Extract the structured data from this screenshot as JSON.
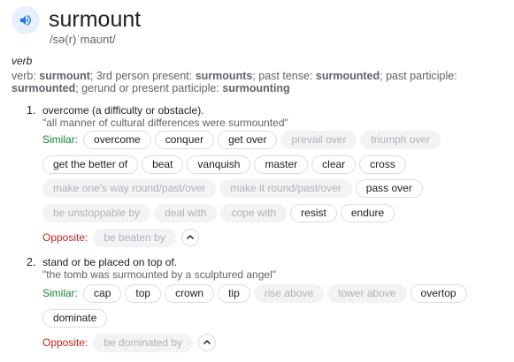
{
  "entry": {
    "word": "surmount",
    "phonetic": "/sə(r)ˈmaʊnt/",
    "part_of_speech": "verb",
    "forms": {
      "prefix": "verb: ",
      "base": "surmount",
      "sep1": "; 3rd person present: ",
      "third_person": "surmounts",
      "sep2": "; past tense: ",
      "past": "surmounted",
      "sep3": "; past participle: ",
      "past_participle": "surmounted",
      "sep4": "; gerund or present participle: ",
      "gerund": "surmounting"
    }
  },
  "senses": [
    {
      "number": "1.",
      "definition": "overcome (a difficulty or obstacle).",
      "example": "\"all manner of cultural differences were surmounted\"",
      "similar_label": "Similar:",
      "similar_rows": [
        [
          {
            "text": "overcome",
            "enabled": true
          },
          {
            "text": "conquer",
            "enabled": true
          },
          {
            "text": "get over",
            "enabled": true
          },
          {
            "text": "prevail over",
            "enabled": false
          },
          {
            "text": "triumph over",
            "enabled": false
          }
        ],
        [
          {
            "text": "get the better of",
            "enabled": true
          },
          {
            "text": "beat",
            "enabled": true
          },
          {
            "text": "vanquish",
            "enabled": true
          },
          {
            "text": "master",
            "enabled": true
          },
          {
            "text": "clear",
            "enabled": true
          },
          {
            "text": "cross",
            "enabled": true
          }
        ],
        [
          {
            "text": "make one's way round/past/over",
            "enabled": false
          },
          {
            "text": "make it round/past/over",
            "enabled": false
          },
          {
            "text": "pass over",
            "enabled": true
          }
        ],
        [
          {
            "text": "be unstoppable by",
            "enabled": false
          },
          {
            "text": "deal with",
            "enabled": false
          },
          {
            "text": "cope with",
            "enabled": false
          },
          {
            "text": "resist",
            "enabled": true
          },
          {
            "text": "endure",
            "enabled": true
          }
        ]
      ],
      "opposite_label": "Opposite:",
      "opposites": [
        {
          "text": "be beaten by",
          "enabled": false
        }
      ]
    },
    {
      "number": "2.",
      "definition": "stand or be placed on top of.",
      "example": "\"the tomb was surmounted by a sculptured angel\"",
      "similar_label": "Similar:",
      "similar_rows": [
        [
          {
            "text": "cap",
            "enabled": true
          },
          {
            "text": "top",
            "enabled": true
          },
          {
            "text": "crown",
            "enabled": true
          },
          {
            "text": "tip",
            "enabled": true
          },
          {
            "text": "rise above",
            "enabled": false
          },
          {
            "text": "tower above",
            "enabled": false
          },
          {
            "text": "overtop",
            "enabled": true
          }
        ],
        [
          {
            "text": "dominate",
            "enabled": true
          }
        ]
      ],
      "opposite_label": "Opposite:",
      "opposites": [
        {
          "text": "be dominated by",
          "enabled": false
        }
      ]
    }
  ],
  "colors": {
    "speaker_accent": "#1a73e8",
    "similar_label": "#188038",
    "opposite_label": "#c5221f",
    "chip_border": "#dadce0",
    "chip_disabled_bg": "#f1f3f4"
  },
  "icons": {
    "pronunciation": "speaker-icon",
    "collapse": "chevron-up-icon"
  }
}
